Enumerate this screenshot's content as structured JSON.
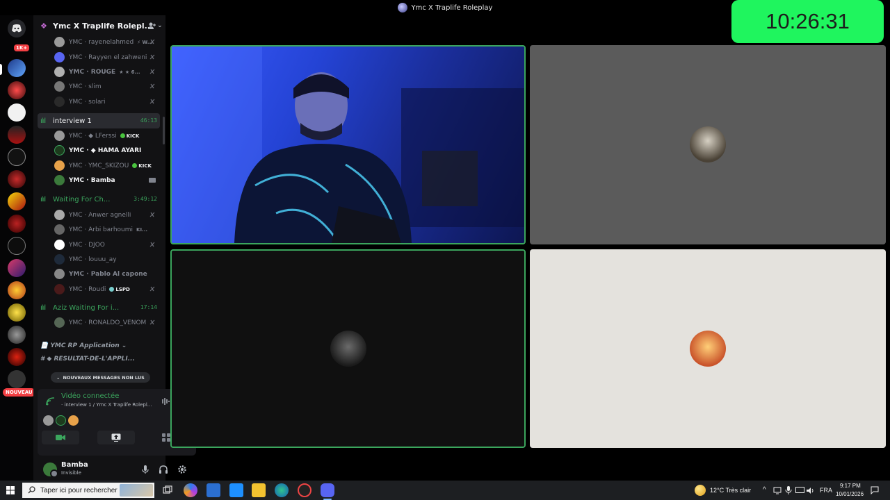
{
  "window": {
    "title": "Ymc X Traplife Roleplay"
  },
  "clock": {
    "time": "10:26:31"
  },
  "rail": {
    "badge": "1K+",
    "new_badge": "NOUVEAU"
  },
  "server": {
    "name": "Ymc X Traplife Rolepl..."
  },
  "channels": {
    "top_members": [
      {
        "name": "YMC · rayenelahmed",
        "extra": "⚡ W..."
      },
      {
        "name": "YMC · Rayyen el zahweni",
        "extra": ""
      },
      {
        "name": "YMC · ROUGE",
        "extra": "★ ★ 6..."
      },
      {
        "name": "YMC · slim",
        "extra": ""
      },
      {
        "name": "YMC · solari",
        "extra": ""
      }
    ],
    "interview": {
      "name": "interview 1",
      "timer": "46:13",
      "members": [
        {
          "name": "YMC · ◆ LFerssi",
          "tag": "KICK"
        },
        {
          "name": "YMC · ◆ HAMA AYARI",
          "tag": ""
        },
        {
          "name": "YMC · YMC_SKIZOU",
          "tag": "KICK"
        },
        {
          "name": "YMC · Bamba",
          "tag": ""
        }
      ]
    },
    "waiting": {
      "name": "Waiting For Ch...",
      "timer": "3:49:12",
      "members": [
        {
          "name": "YMC · Anwer agnelli",
          "tag": ""
        },
        {
          "name": "YMC · Arbi barhoumi",
          "tag": "KI..."
        },
        {
          "name": "YMC · DJOO",
          "tag": ""
        },
        {
          "name": "YMC · louuu_ay",
          "tag": ""
        },
        {
          "name": "YMC · Pablo Al capone",
          "tag": ""
        },
        {
          "name": "YMC · Roudi",
          "tag": "LSPD"
        }
      ]
    },
    "aziz": {
      "name": "Aziz Waiting For i...",
      "timer": "17:14",
      "members": [
        {
          "name": "YMC · RONALDO_VENOM",
          "tag": ""
        }
      ]
    },
    "category": "YMC RP Application",
    "text_channel": "◆ RESULTAT-DE-L'APPLI...",
    "unread": "NOUVEAUX MESSAGES NON LUS"
  },
  "voice_panel": {
    "status": "Vidéo connectée",
    "location": "· interview 1 / Ymc X Traplife Rolepl..."
  },
  "user": {
    "name": "Bamba",
    "status": "Invisible"
  },
  "taskbar": {
    "search_placeholder": "Taper ici pour rechercher",
    "weather": "12°C  Très clair",
    "lang": "FRA",
    "time": "9:17 PM",
    "date": "10/01/2026"
  },
  "colors": {
    "accent_green": "#3ba55d",
    "clock_bg": "#1ff55e",
    "sidebar_bg": "#121214"
  }
}
